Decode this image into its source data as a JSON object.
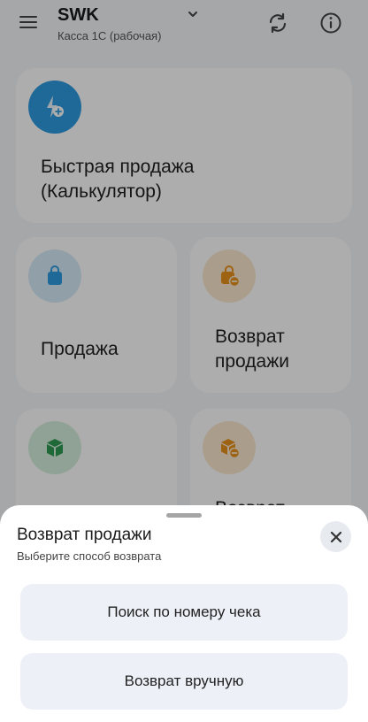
{
  "header": {
    "title": "SWK",
    "subtitle": "Касса 1С (рабочая)"
  },
  "cards": {
    "quick_sale": {
      "label": "Быстрая продажа (Калькулятор)"
    },
    "sale": {
      "label": "Продажа"
    },
    "return_sale": {
      "label": "Возврат продажи"
    },
    "card4": {
      "label": "Возврат"
    }
  },
  "sheet": {
    "title": "Возврат продажи",
    "subtitle": "Выберите способ возврата",
    "option_search": "Поиск по номеру чека",
    "option_manual": "Возврат вручную"
  },
  "colors": {
    "accent_blue": "#2e9be0",
    "accent_orange": "#e8921c",
    "accent_green": "#2e9a52"
  }
}
